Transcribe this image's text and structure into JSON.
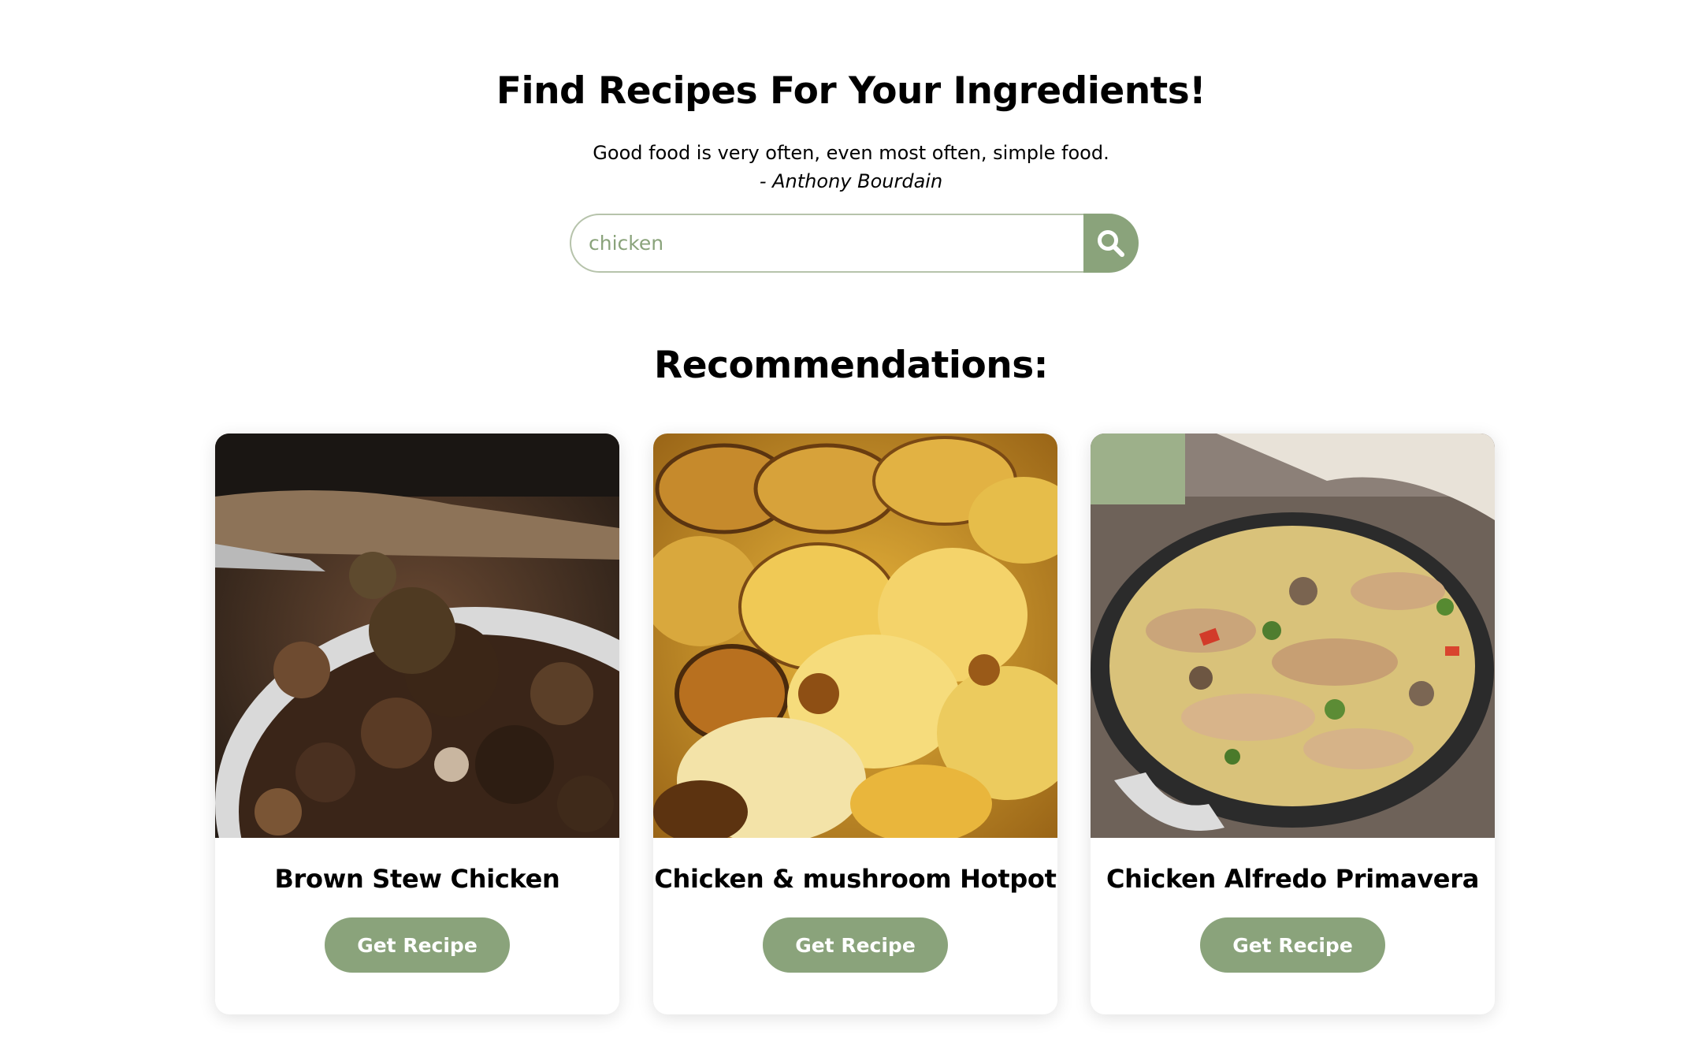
{
  "header": {
    "title": "Find Recipes For Your Ingredients!",
    "quote_text": "Good food is very often, even most often, simple food.",
    "quote_author": "- Anthony Bourdain"
  },
  "search": {
    "value": "chicken",
    "icon": "search-icon"
  },
  "recommendations": {
    "heading": "Recommendations:",
    "cards": [
      {
        "title": "Brown Stew Chicken",
        "button_label": "Get Recipe",
        "image": "brown-stew-chicken-photo"
      },
      {
        "title": "Chicken & mushroom Hotpot",
        "button_label": "Get Recipe",
        "image": "chicken-mushroom-hotpot-photo"
      },
      {
        "title": "Chicken Alfredo Primavera",
        "button_label": "Get Recipe",
        "image": "chicken-alfredo-primavera-photo"
      }
    ]
  },
  "colors": {
    "accent": "#8aa37b",
    "search_border": "#b6c3ab",
    "text": "#000000",
    "background": "#ffffff"
  }
}
